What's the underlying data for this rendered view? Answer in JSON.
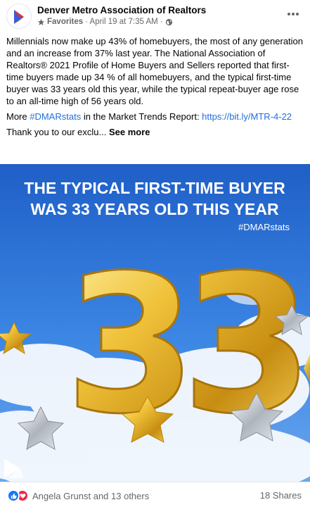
{
  "post": {
    "page_name": "Denver Metro Association of Realtors",
    "meta": {
      "favorites": "Favorites",
      "timestamp": "· April 19 at 7:35 AM ·"
    },
    "body": {
      "paragraph1": "Millennials now make up 43% of homebuyers, the most of any generation and an increase from 37% last year. The National Association of Realtors® 2021 Profile of Home Buyers and Sellers reported that first-time buyers made up 34 % of all homebuyers, and the typical first-time buyer was 33 years old this year, while the typical repeat-buyer age rose to an all-time high of 56 years old.",
      "more_prefix": "More ",
      "hashtag": "#DMARstats",
      "more_middle": " in the Market Trends Report: ",
      "url": "https://bit.ly/MTR-4-22",
      "thanks_text": "Thank you to our exclu... ",
      "see_more": "See more"
    },
    "image": {
      "headline_line1": "THE TYPICAL FIRST-TIME BUYER",
      "headline_line2": "WAS 33 YEARS OLD THIS YEAR",
      "hashtag": "#DMARstats",
      "balloon_number": "33"
    },
    "footer": {
      "reactions_text": "Angela Grunst and 13 others",
      "shares": "18 Shares"
    }
  },
  "colors": {
    "link": "#216fdb",
    "sky": "#2b6fd3",
    "gold": "#e8b82a",
    "like": "#1877f2",
    "love": "#f0284a"
  },
  "icons": [
    "page-avatar-logo",
    "star-icon",
    "globe-icon",
    "more-options-icon",
    "like-reaction-icon",
    "love-reaction-icon",
    "brand-logo"
  ]
}
